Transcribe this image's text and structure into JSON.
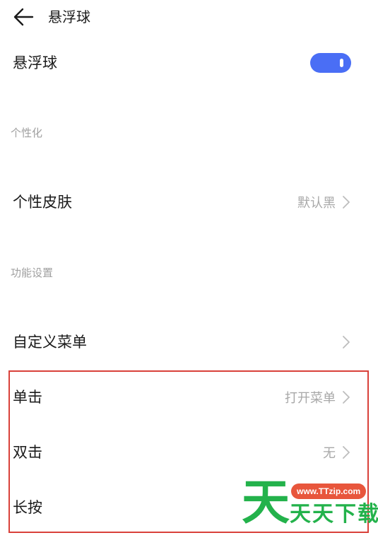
{
  "header": {
    "title": "悬浮球",
    "back_icon": "arrow-left-icon"
  },
  "main_toggle": {
    "label": "悬浮球",
    "enabled": true,
    "accent_color": "#4a6ef5"
  },
  "sections": {
    "personalization": {
      "title": "个性化",
      "skin": {
        "label": "个性皮肤",
        "value": "默认黑"
      }
    },
    "functions": {
      "title": "功能设置",
      "custom_menu": {
        "label": "自定义菜单"
      },
      "single_tap": {
        "label": "单击",
        "value": "打开菜单"
      },
      "double_tap": {
        "label": "双击",
        "value": "无"
      },
      "long_press": {
        "label": "长按"
      }
    }
  },
  "watermark": {
    "big_char": "天",
    "url": "www.TTzip.com",
    "text": "天天下载"
  },
  "colors": {
    "highlight_border": "#d9413a",
    "watermark_green": "#23b24b",
    "watermark_orange": "#e8563c"
  }
}
